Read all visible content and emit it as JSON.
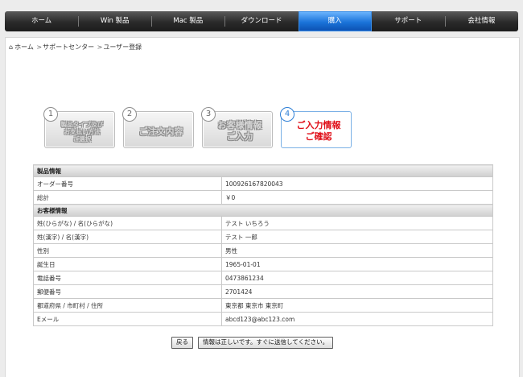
{
  "nav": {
    "items": [
      "ホーム",
      "Win 製品",
      "Mac 製品",
      "ダウンロード",
      "購入",
      "サポート",
      "会社情報"
    ],
    "active": "購入"
  },
  "breadcrumb": [
    "ホーム",
    "サポートセンター",
    "ユーザー登録"
  ],
  "steps": [
    {
      "num": "1",
      "lines": [
        "製品タイプ及び",
        "お支払い方法",
        "ご選択"
      ]
    },
    {
      "num": "2",
      "lines": [
        "ご注文内容"
      ]
    },
    {
      "num": "3",
      "lines": [
        "お客様情報",
        "ご入力"
      ]
    },
    {
      "num": "4",
      "lines": [
        "ご入力情報",
        "ご確認"
      ]
    }
  ],
  "product_section": "製品情報",
  "product_rows": [
    {
      "label": "オーダー番号",
      "value": "100926167820043"
    },
    {
      "label": "総計",
      "value": "￥0"
    }
  ],
  "customer_section": "お客様情報",
  "customer_rows": [
    {
      "label": "姓(ひらがな) / 名(ひらがな)",
      "value": "テスト いちろう"
    },
    {
      "label": "姓(漢字) / 名(漢字)",
      "value": "テスト 一郎"
    },
    {
      "label": "性別",
      "value": "男性"
    },
    {
      "label": "誕生日",
      "value": "1965-01-01"
    },
    {
      "label": "電話番号",
      "value": "0473861234"
    },
    {
      "label": "郵便番号",
      "value": "2701424"
    },
    {
      "label": "都道府県 / 市町村 / 住所",
      "value": "東京都 東京市 東京町"
    },
    {
      "label": "Eメール",
      "value": "abcd123@abc123.com"
    }
  ],
  "buttons": {
    "back": "戻る",
    "submit": "情報は正しいです。すぐに送信してください。"
  }
}
